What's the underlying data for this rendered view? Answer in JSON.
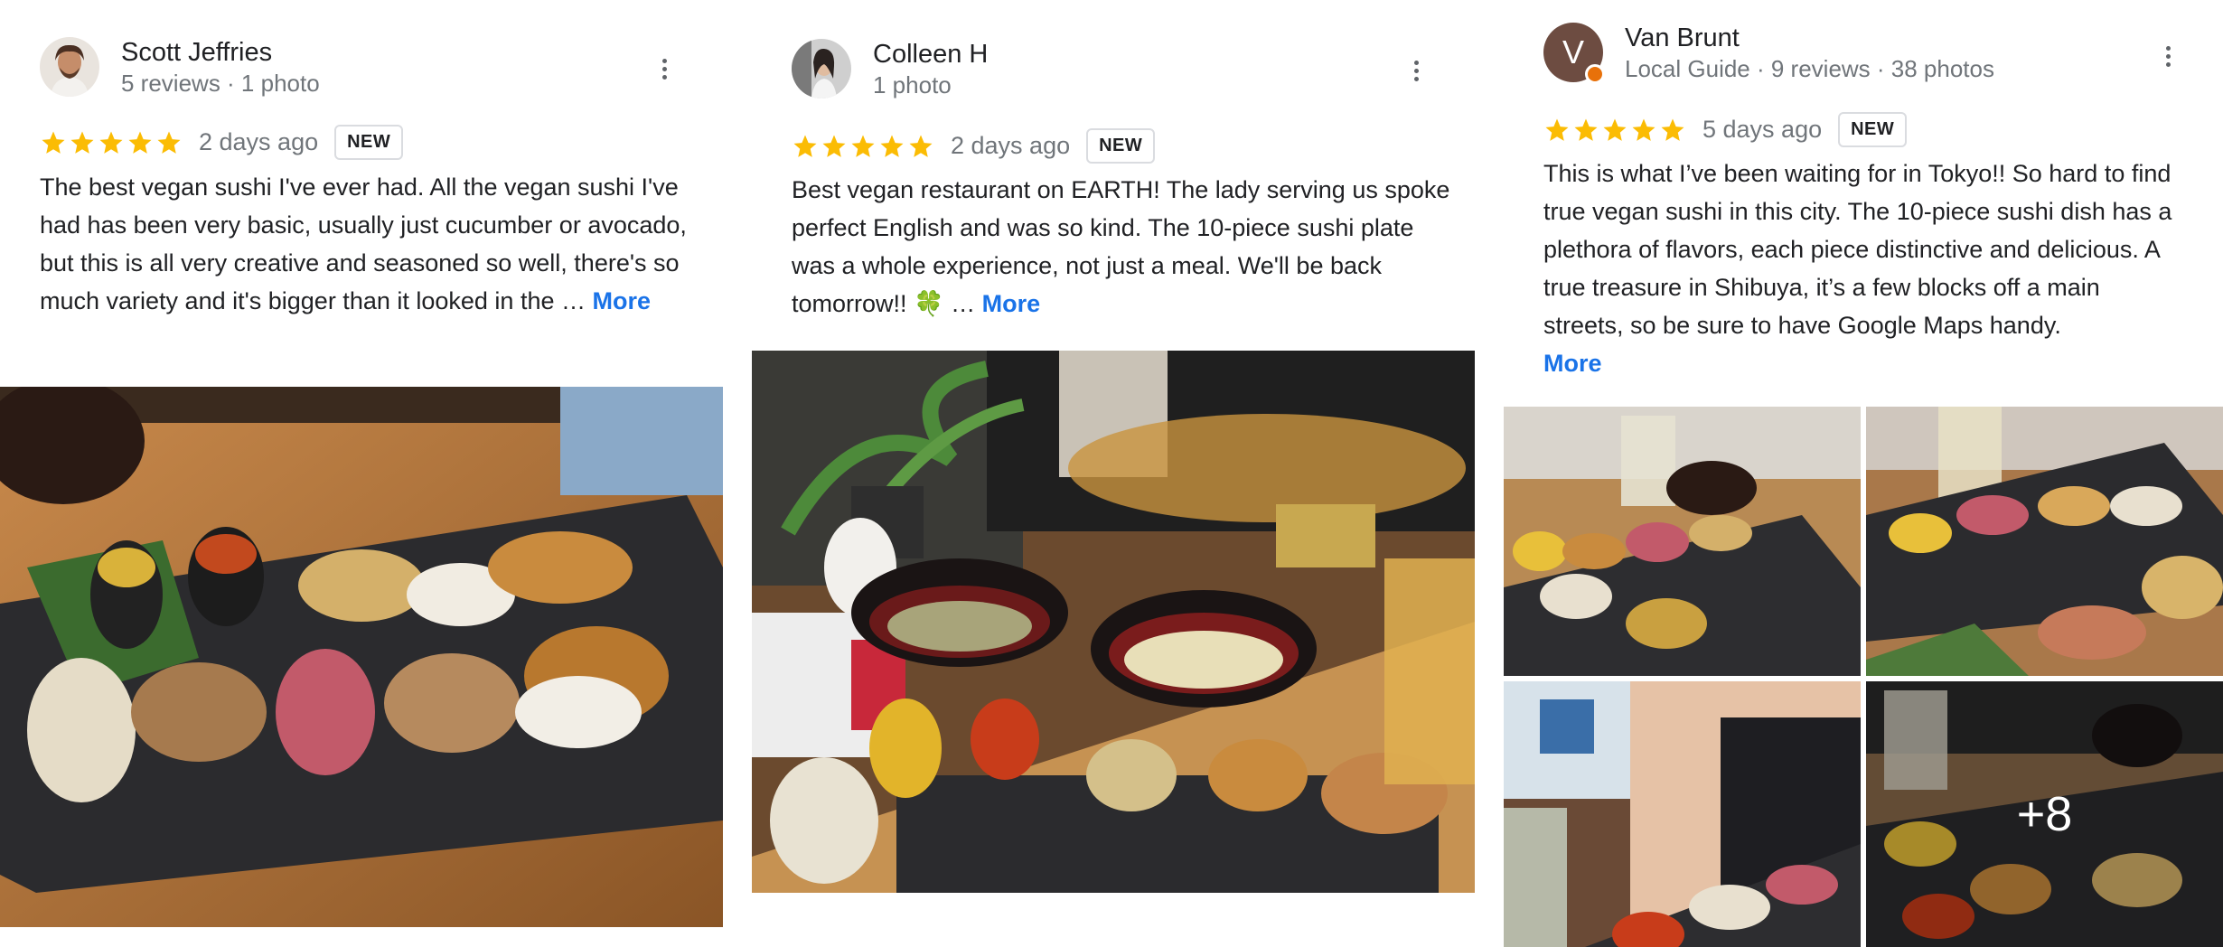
{
  "reviews": [
    {
      "author": "Scott Jeffries",
      "meta": "5 reviews · 1 photo",
      "rating": 5,
      "time_ago": "2 days ago",
      "badge": "NEW",
      "text": "The best vegan sushi I've ever had. All the vegan sushi I've had has been very basic, usually just cucumber or avocado, but this is all very creative and seasoned so well, there's so much variety and it's bigger than it looked in the … ",
      "more_label": "More"
    },
    {
      "author": "Colleen H",
      "meta": "1 photo",
      "rating": 5,
      "time_ago": "2 days ago",
      "badge": "NEW",
      "text": "Best vegan restaurant on EARTH! The lady serving us spoke perfect English and was so kind. The 10-piece sushi plate was a whole experience, not just a meal. We'll be back tomorrow!! 🍀 … ",
      "more_label": "More"
    },
    {
      "author": "Van Brunt",
      "avatar_letter": "V",
      "meta": "Local Guide · 9 reviews · 38 photos",
      "rating": 5,
      "time_ago": "5 days ago",
      "badge": "NEW",
      "text": "This is what I’ve been waiting for in Tokyo!! So hard to find true vegan sushi in this city. The 10-piece sushi dish has a plethora of flavors, each piece distinctive and delicious. A true treasure in Shibuya, it’s a few blocks off a main streets, so be sure to have Google Maps handy. ",
      "more_label": "More",
      "extra_photos_label": "+8"
    }
  ],
  "colors": {
    "star": "#fbbc04",
    "link": "#1a73e8",
    "secondary_text": "#70757a",
    "local_guide_badge": "#e8710a"
  },
  "icons": [
    "more-vert-icon",
    "star-icon"
  ]
}
